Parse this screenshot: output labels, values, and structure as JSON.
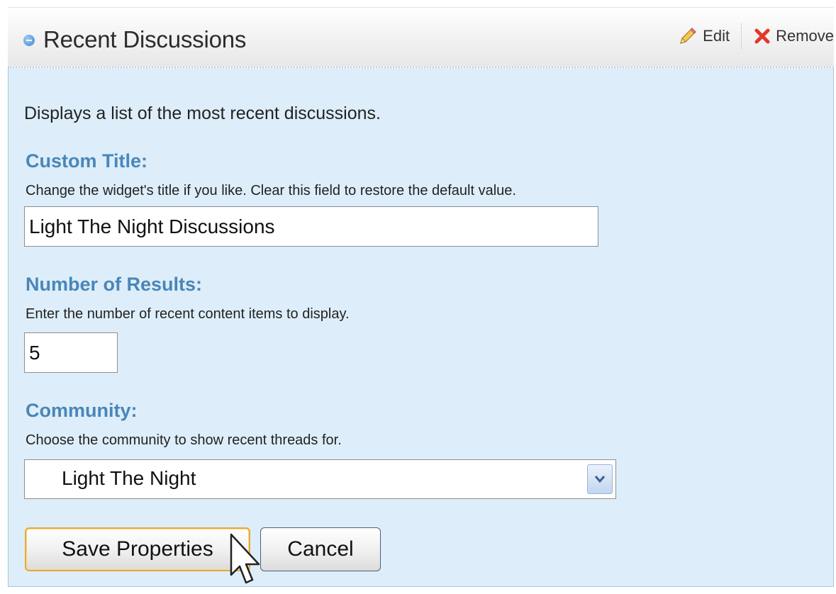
{
  "widget": {
    "title": "Recent Discussions",
    "edit_label": "Edit",
    "remove_label": "Remove",
    "description": "Displays a list of the most recent discussions."
  },
  "custom_title": {
    "label": "Custom Title:",
    "help": "Change the widget's title if you like. Clear this field to restore the default value.",
    "value": "Light The Night Discussions"
  },
  "num_results": {
    "label": "Number of Results:",
    "help": "Enter the number of recent content items to display.",
    "value": "5"
  },
  "community": {
    "label": "Community:",
    "help": "Choose the community to show recent threads for.",
    "selected": "Light The Night"
  },
  "buttons": {
    "save": "Save Properties",
    "cancel": "Cancel"
  },
  "colors": {
    "panel_bg": "#ddeefa",
    "label_blue": "#4a86b8",
    "save_border": "#e7a93a"
  },
  "icons": [
    "collapse-icon",
    "pencil-icon",
    "close-x-icon",
    "chevron-down-icon",
    "mouse-pointer-icon"
  ]
}
